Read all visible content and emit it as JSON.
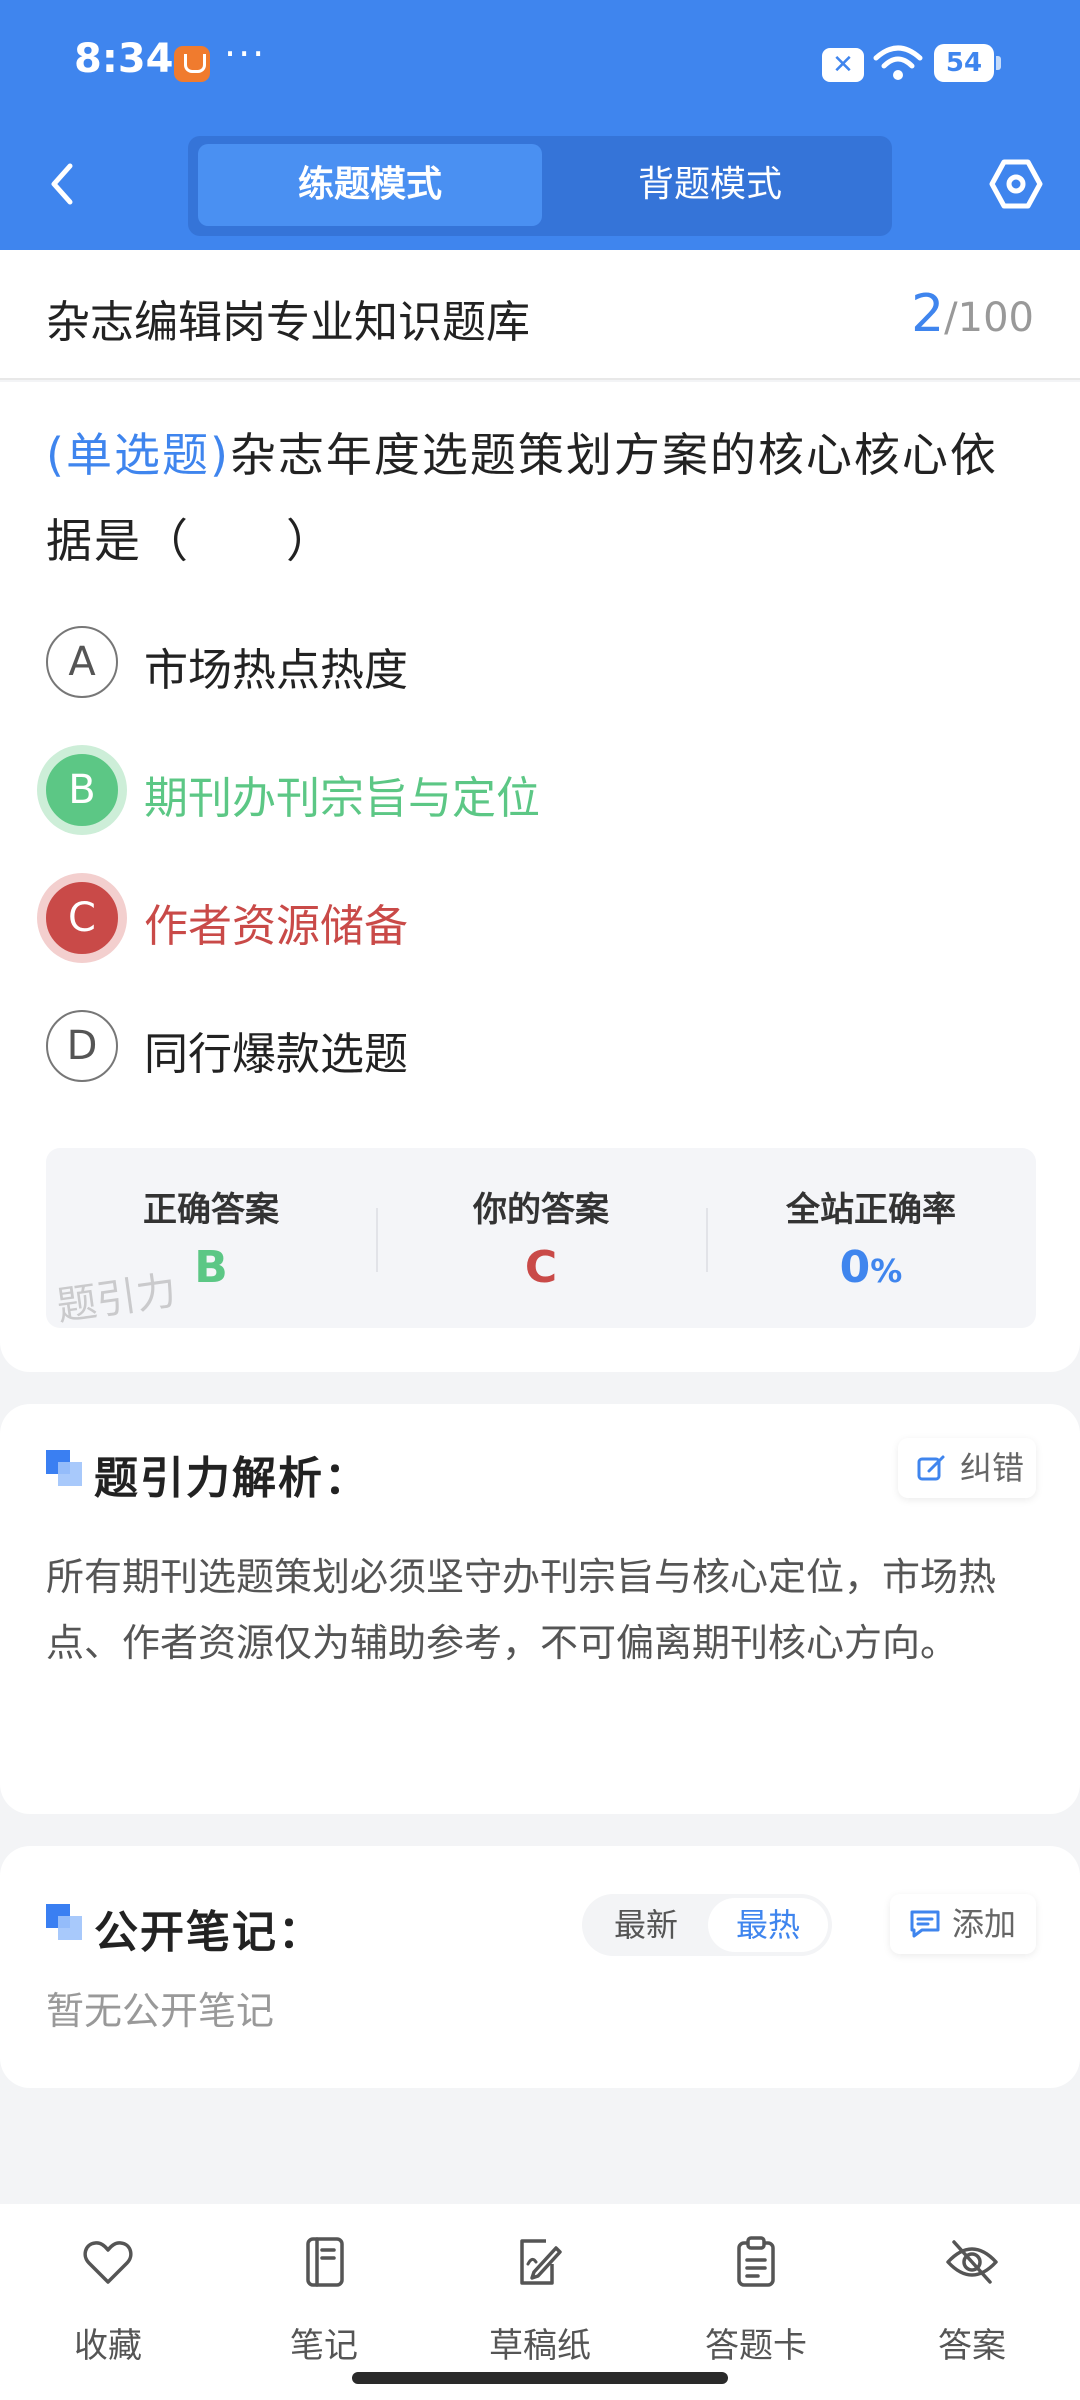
{
  "status": {
    "time": "8:34",
    "dots": "···",
    "battery": "54",
    "x_badge": "✕"
  },
  "header": {
    "tabs": [
      {
        "label": "练题模式",
        "active": true
      },
      {
        "label": "背题模式",
        "active": false
      }
    ]
  },
  "bank": {
    "title": "杂志编辑岗专业知识题库",
    "current": "2",
    "total": "/100"
  },
  "question": {
    "type": "(单选题)",
    "text": "杂志年度选题策划方案的核心核心依据是（　　）",
    "options": [
      {
        "letter": "A",
        "text": "市场热点热度",
        "state": "normal"
      },
      {
        "letter": "B",
        "text": "期刊办刊宗旨与定位",
        "state": "correct"
      },
      {
        "letter": "C",
        "text": "作者资源储备",
        "state": "wrong"
      },
      {
        "letter": "D",
        "text": "同行爆款选题",
        "state": "normal"
      }
    ]
  },
  "answer": {
    "correct_label": "正确答案",
    "correct_value": "B",
    "yours_label": "你的答案",
    "yours_value": "C",
    "rate_label": "全站正确率",
    "rate_value": "0",
    "rate_unit": "%",
    "watermark": "题引力",
    "colors": {
      "correct": "#5cc785",
      "wrong": "#c94a48",
      "rate": "#3f85ee"
    }
  },
  "analysis": {
    "title": "题引力解析：",
    "report_label": "纠错",
    "text": "所有期刊选题策划必须坚守办刊宗旨与核心定位，市场热点、作者资源仅为辅助参考，不可偏离期刊核心方向。"
  },
  "notes": {
    "title": "公开笔记：",
    "sort_latest": "最新",
    "sort_hot": "最热",
    "add_label": "添加",
    "empty": "暂无公开笔记"
  },
  "bottom_nav": [
    {
      "label": "收藏",
      "icon": "heart-icon"
    },
    {
      "label": "笔记",
      "icon": "notebook-icon"
    },
    {
      "label": "草稿纸",
      "icon": "draft-icon"
    },
    {
      "label": "答题卡",
      "icon": "clipboard-icon"
    },
    {
      "label": "答案",
      "icon": "eye-off-icon"
    }
  ],
  "theme": {
    "accent": "#3f85ee"
  }
}
